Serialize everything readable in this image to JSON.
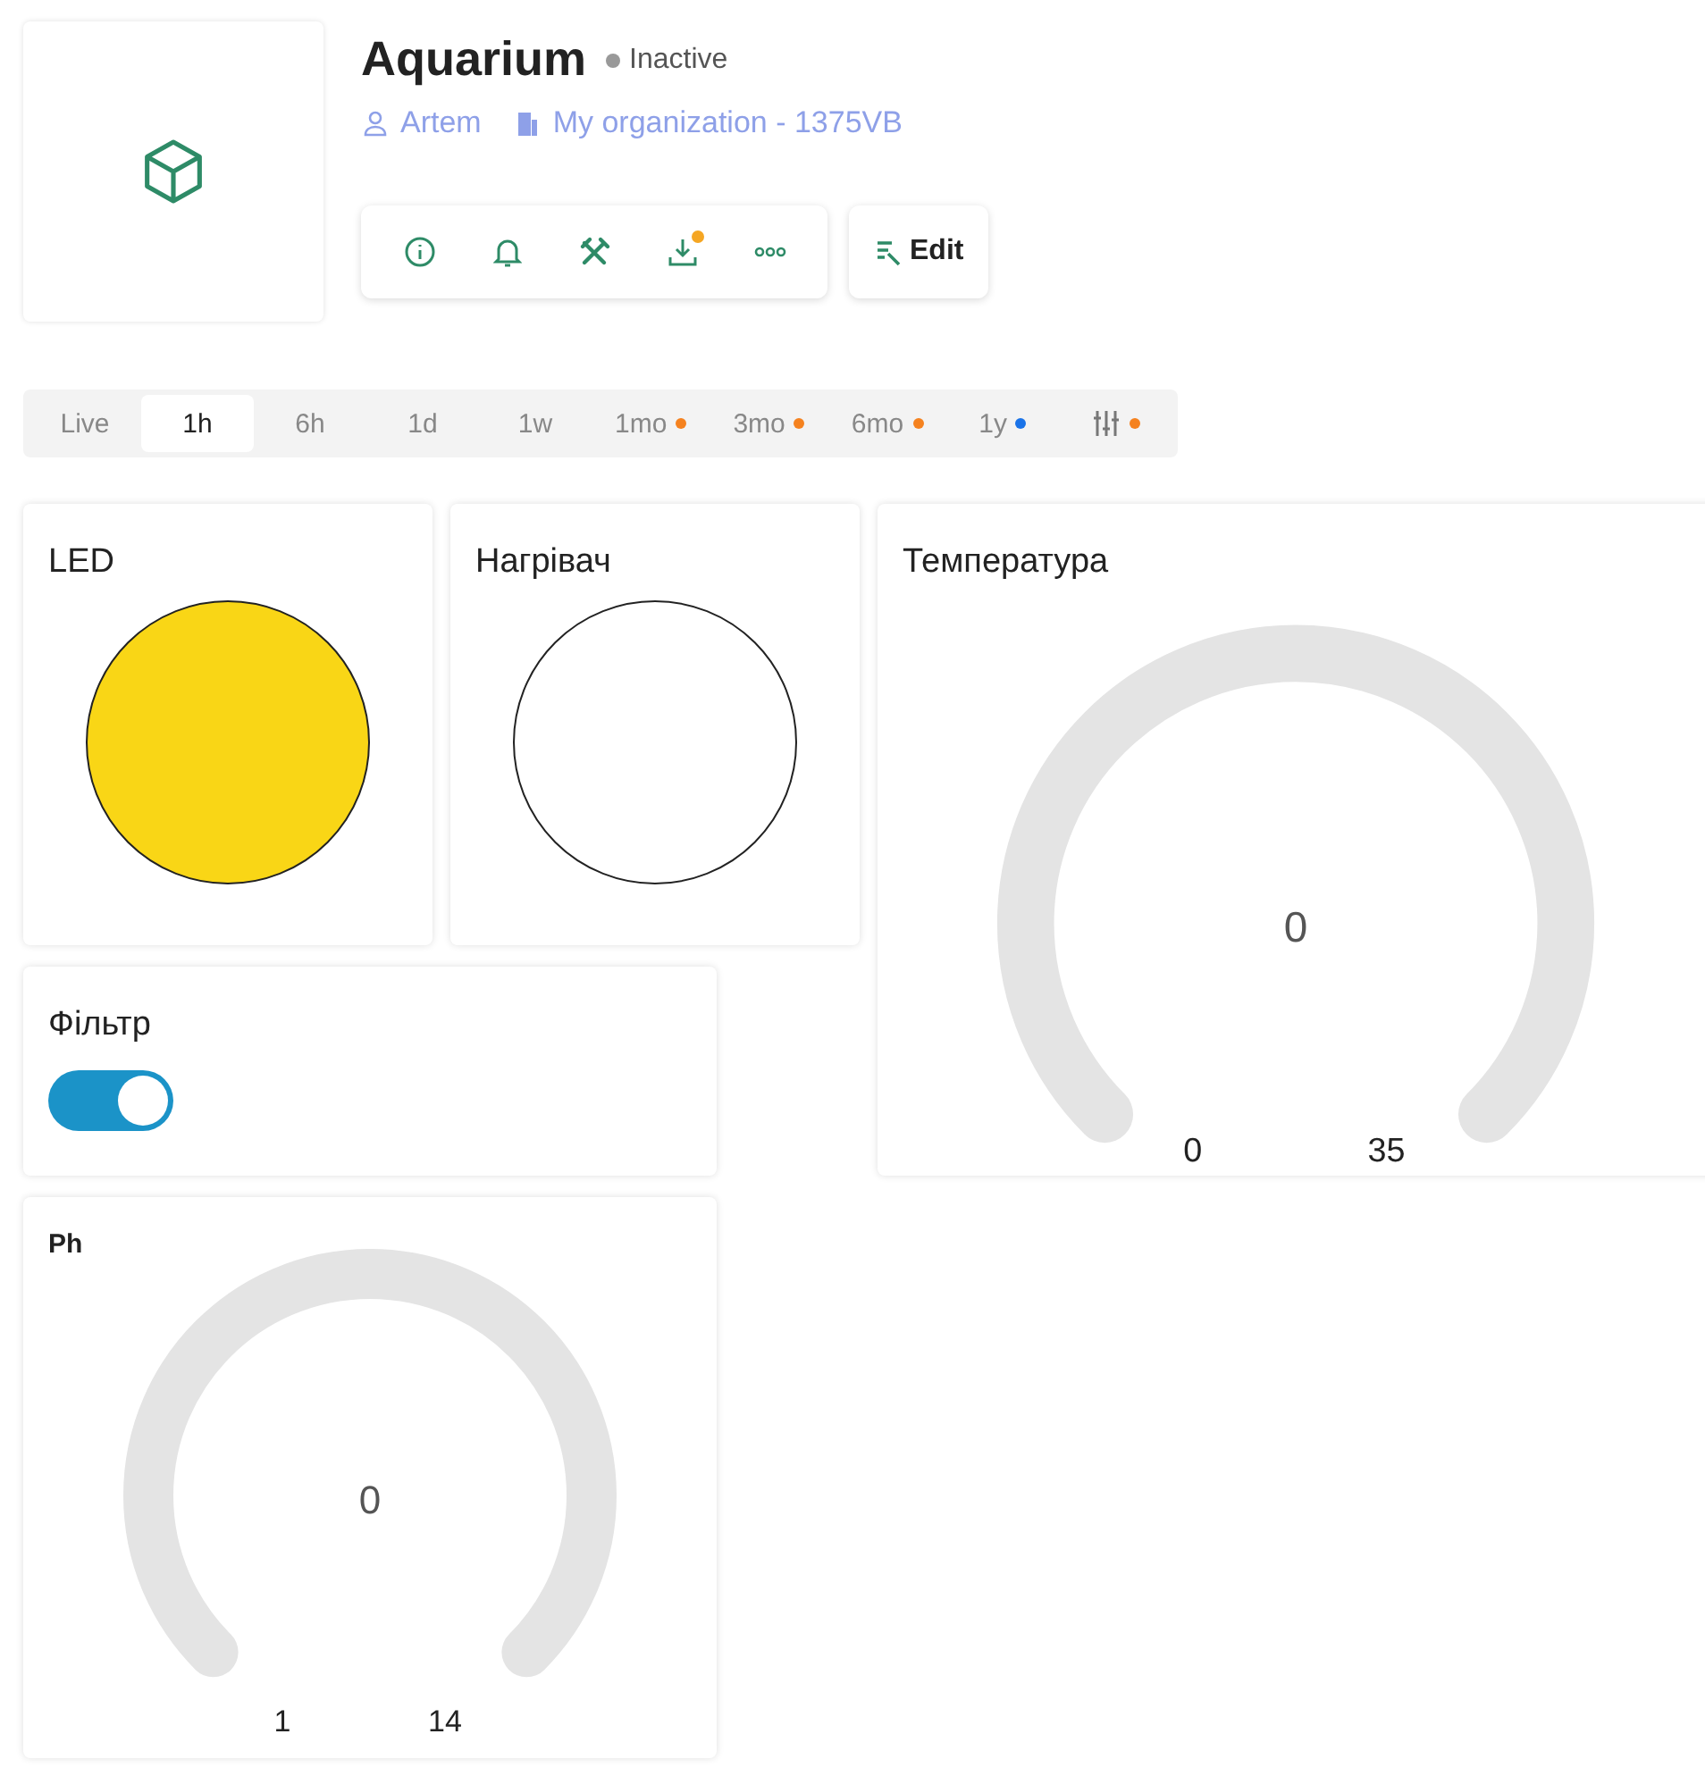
{
  "device": {
    "title": "Aquarium",
    "status": "Inactive",
    "owner": "Artem",
    "organization": "My organization - 1375VB"
  },
  "toolbar": {
    "download_badge": true,
    "edit_label": "Edit"
  },
  "time_ranges": [
    {
      "kind": "text",
      "label": "Live",
      "selected": false
    },
    {
      "kind": "text",
      "label": "1h",
      "selected": true
    },
    {
      "kind": "text",
      "label": "6h",
      "selected": false
    },
    {
      "kind": "text",
      "label": "1d",
      "selected": false
    },
    {
      "kind": "text",
      "label": "1w",
      "selected": false
    },
    {
      "kind": "text",
      "label": "1mo",
      "selected": false,
      "color": "#f5821f"
    },
    {
      "kind": "text",
      "label": "3mo",
      "selected": false,
      "color": "#f5821f"
    },
    {
      "kind": "text",
      "label": "6mo",
      "selected": false,
      "color": "#f5821f"
    },
    {
      "kind": "text",
      "label": "1y",
      "selected": false,
      "color": "#1a73e8"
    },
    {
      "kind": "filter",
      "selected": false,
      "color": "#f5821f"
    }
  ],
  "widgets": {
    "led": {
      "title": "LED",
      "on": true
    },
    "heater": {
      "title": "Нагрівач",
      "on": false
    },
    "temperature": {
      "title": "Температура",
      "value": "0",
      "min": "0",
      "max": "35"
    },
    "filter": {
      "title": "Фільтр",
      "on": true
    },
    "ph": {
      "title": "Ph",
      "value": "0",
      "min": "1",
      "max": "14"
    }
  }
}
